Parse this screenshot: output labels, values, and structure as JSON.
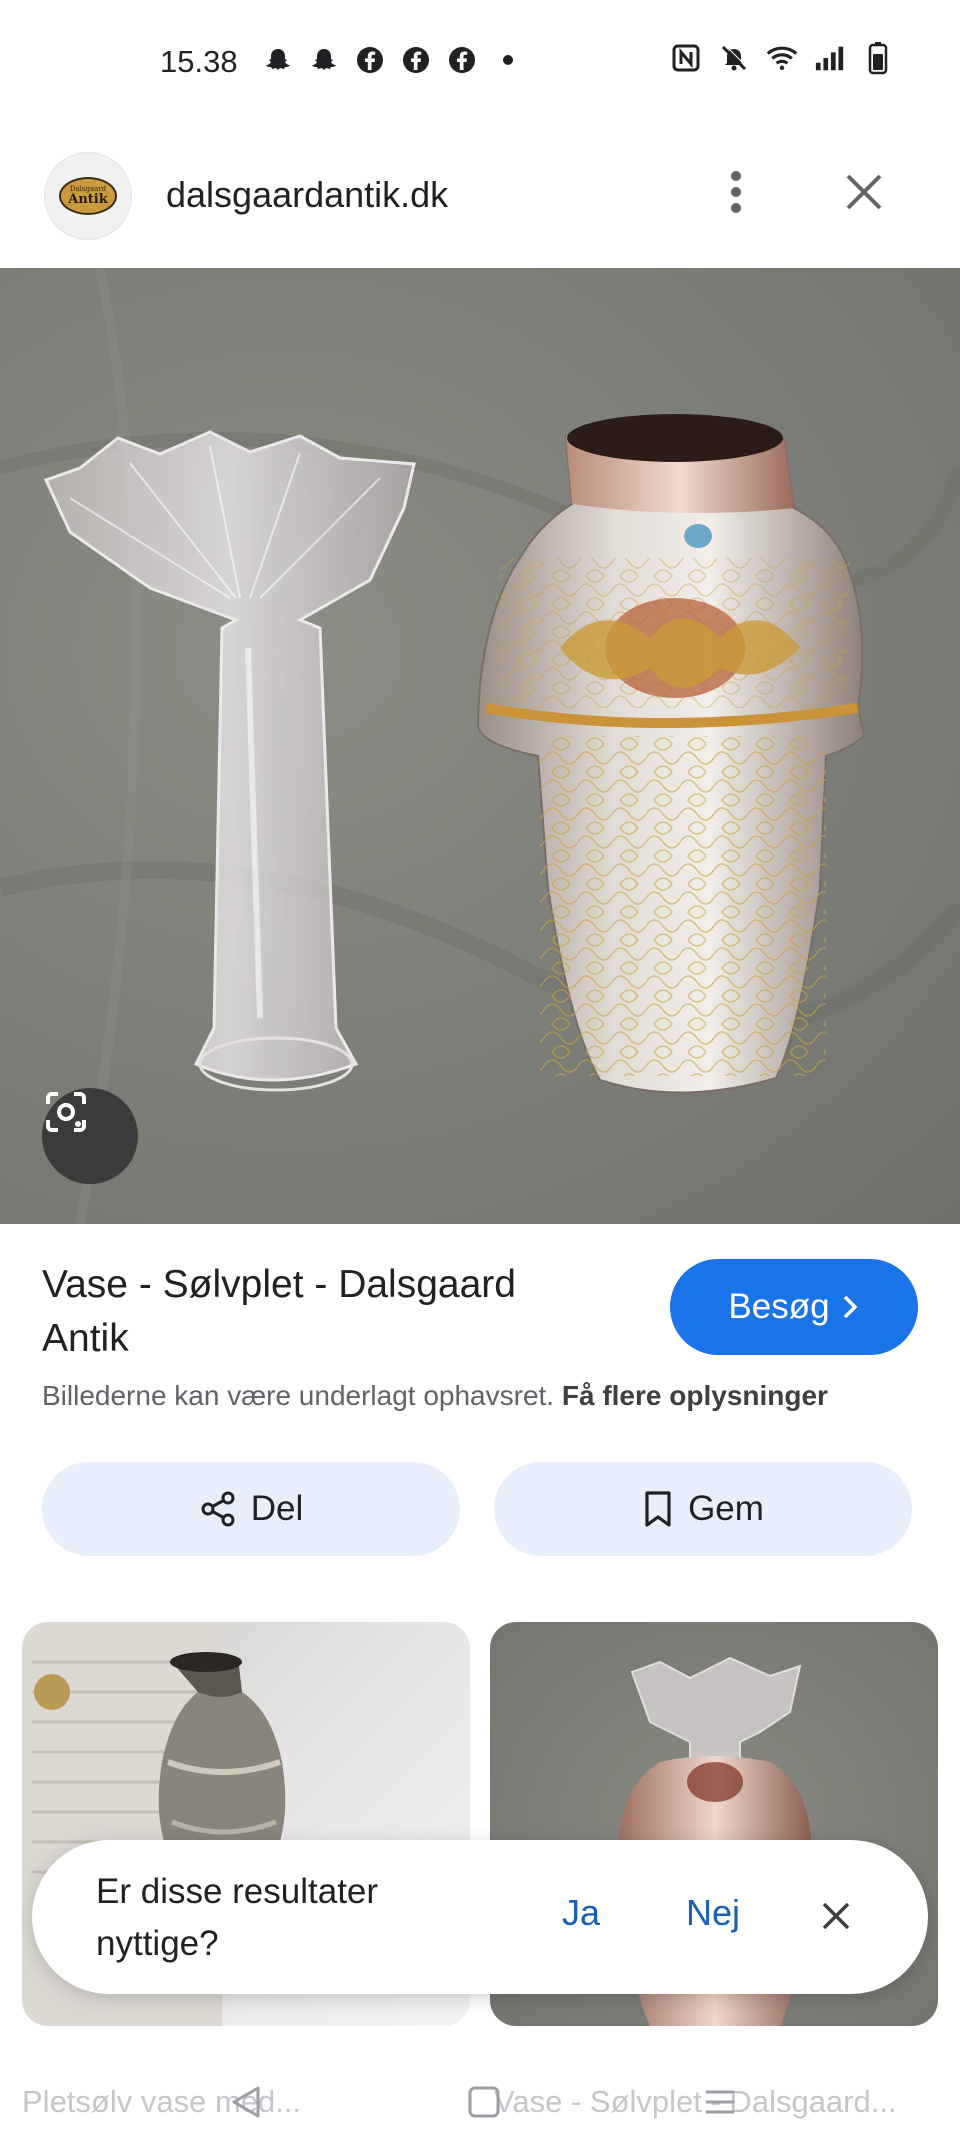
{
  "status_bar": {
    "time": "15.38",
    "left_icons": [
      "snapchat-icon",
      "snapchat-icon",
      "facebook-icon",
      "facebook-icon",
      "facebook-icon",
      "dot-icon"
    ],
    "right_icons": [
      "nfc-icon",
      "mute-icon",
      "wifi-icon",
      "signal-icon",
      "battery-icon"
    ]
  },
  "header": {
    "logo_text_small": "Dalsgaard",
    "logo_text_big": "Antik",
    "domain": "dalsgaardantik.dk"
  },
  "result": {
    "title": "Vase - Sølvplet - Dalsgaard Antik",
    "visit_label": "Besøg",
    "copyright_text": "Billederne kan være underlagt ophavsret.",
    "copyright_link": "Få flere oplysninger"
  },
  "actions": {
    "share_label": "Del",
    "save_label": "Gem"
  },
  "related": [
    {
      "caption": "Pletsølv vase med..."
    },
    {
      "caption": "Vase - Sølvplet - Dalsgaard..."
    }
  ],
  "feedback": {
    "question": "Er disse resultater nyttige?",
    "yes_label": "Ja",
    "no_label": "Nej"
  },
  "colors": {
    "accent": "#1a73e8",
    "chip_bg": "#e8effb",
    "link_blue": "#1a5fb4"
  }
}
